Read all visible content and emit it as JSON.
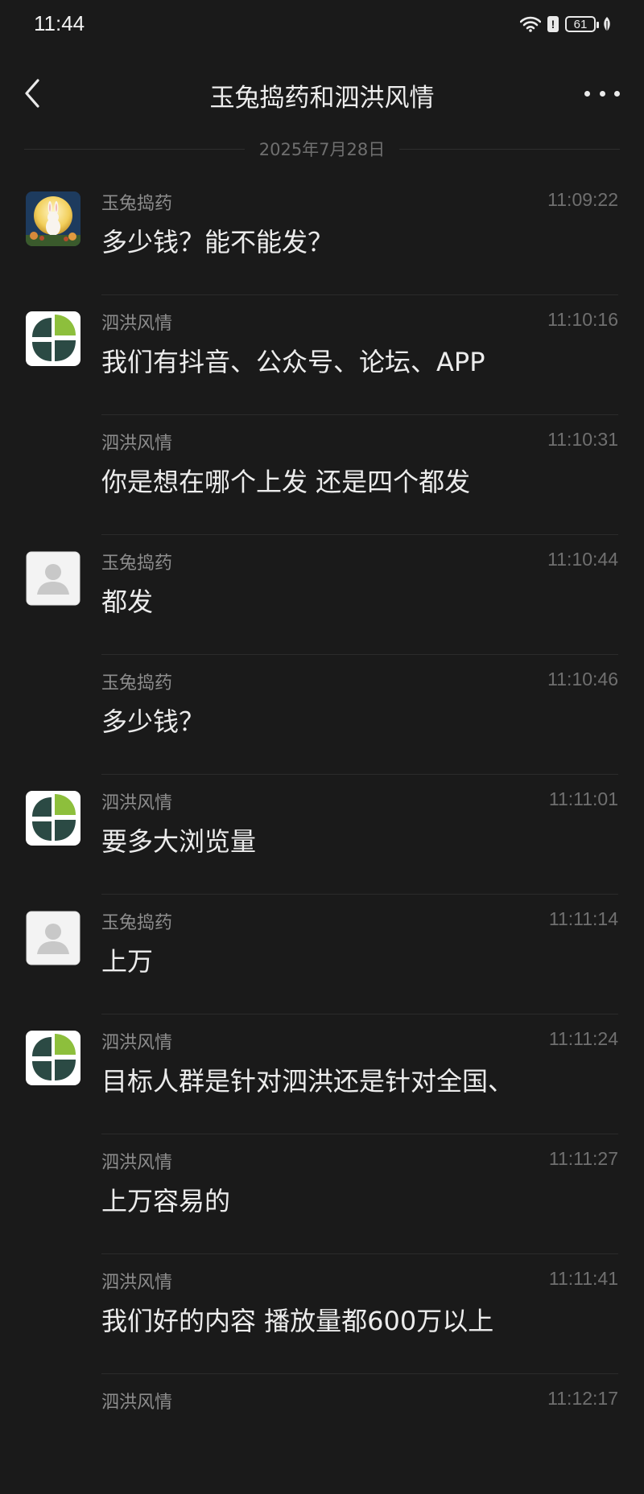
{
  "status_bar": {
    "time": "11:44",
    "battery": "61"
  },
  "header": {
    "title": "玉兔捣药和泗洪风情"
  },
  "date_separator": "2025年7月28日",
  "messages": [
    {
      "name": "玉兔捣药",
      "time": "11:09:22",
      "text": "多少钱？能不能发？",
      "avatar": "moon-rabbit"
    },
    {
      "name": "泗洪风情",
      "time": "11:10:16",
      "text": "我们有抖音、公众号、论坛、APP",
      "avatar": "leaf-logo"
    },
    {
      "name": "泗洪风情",
      "time": "11:10:31",
      "text": "你是想在哪个上发 还是四个都发",
      "avatar": "none"
    },
    {
      "name": "玉兔捣药",
      "time": "11:10:44",
      "text": "都发",
      "avatar": "default-user"
    },
    {
      "name": "玉兔捣药",
      "time": "11:10:46",
      "text": "多少钱？",
      "avatar": "none"
    },
    {
      "name": "泗洪风情",
      "time": "11:11:01",
      "text": "要多大浏览量",
      "avatar": "leaf-logo"
    },
    {
      "name": "玉兔捣药",
      "time": "11:11:14",
      "text": "上万",
      "avatar": "default-user"
    },
    {
      "name": "泗洪风情",
      "time": "11:11:24",
      "text": "目标人群是针对泗洪还是针对全国、",
      "avatar": "leaf-logo"
    },
    {
      "name": "泗洪风情",
      "time": "11:11:27",
      "text": "上万容易的",
      "avatar": "none"
    },
    {
      "name": "泗洪风情",
      "time": "11:11:41",
      "text": "我们好的内容 播放量都600万以上",
      "avatar": "none"
    },
    {
      "name": "泗洪风情",
      "time": "11:12:17",
      "text": "",
      "avatar": "none"
    }
  ]
}
